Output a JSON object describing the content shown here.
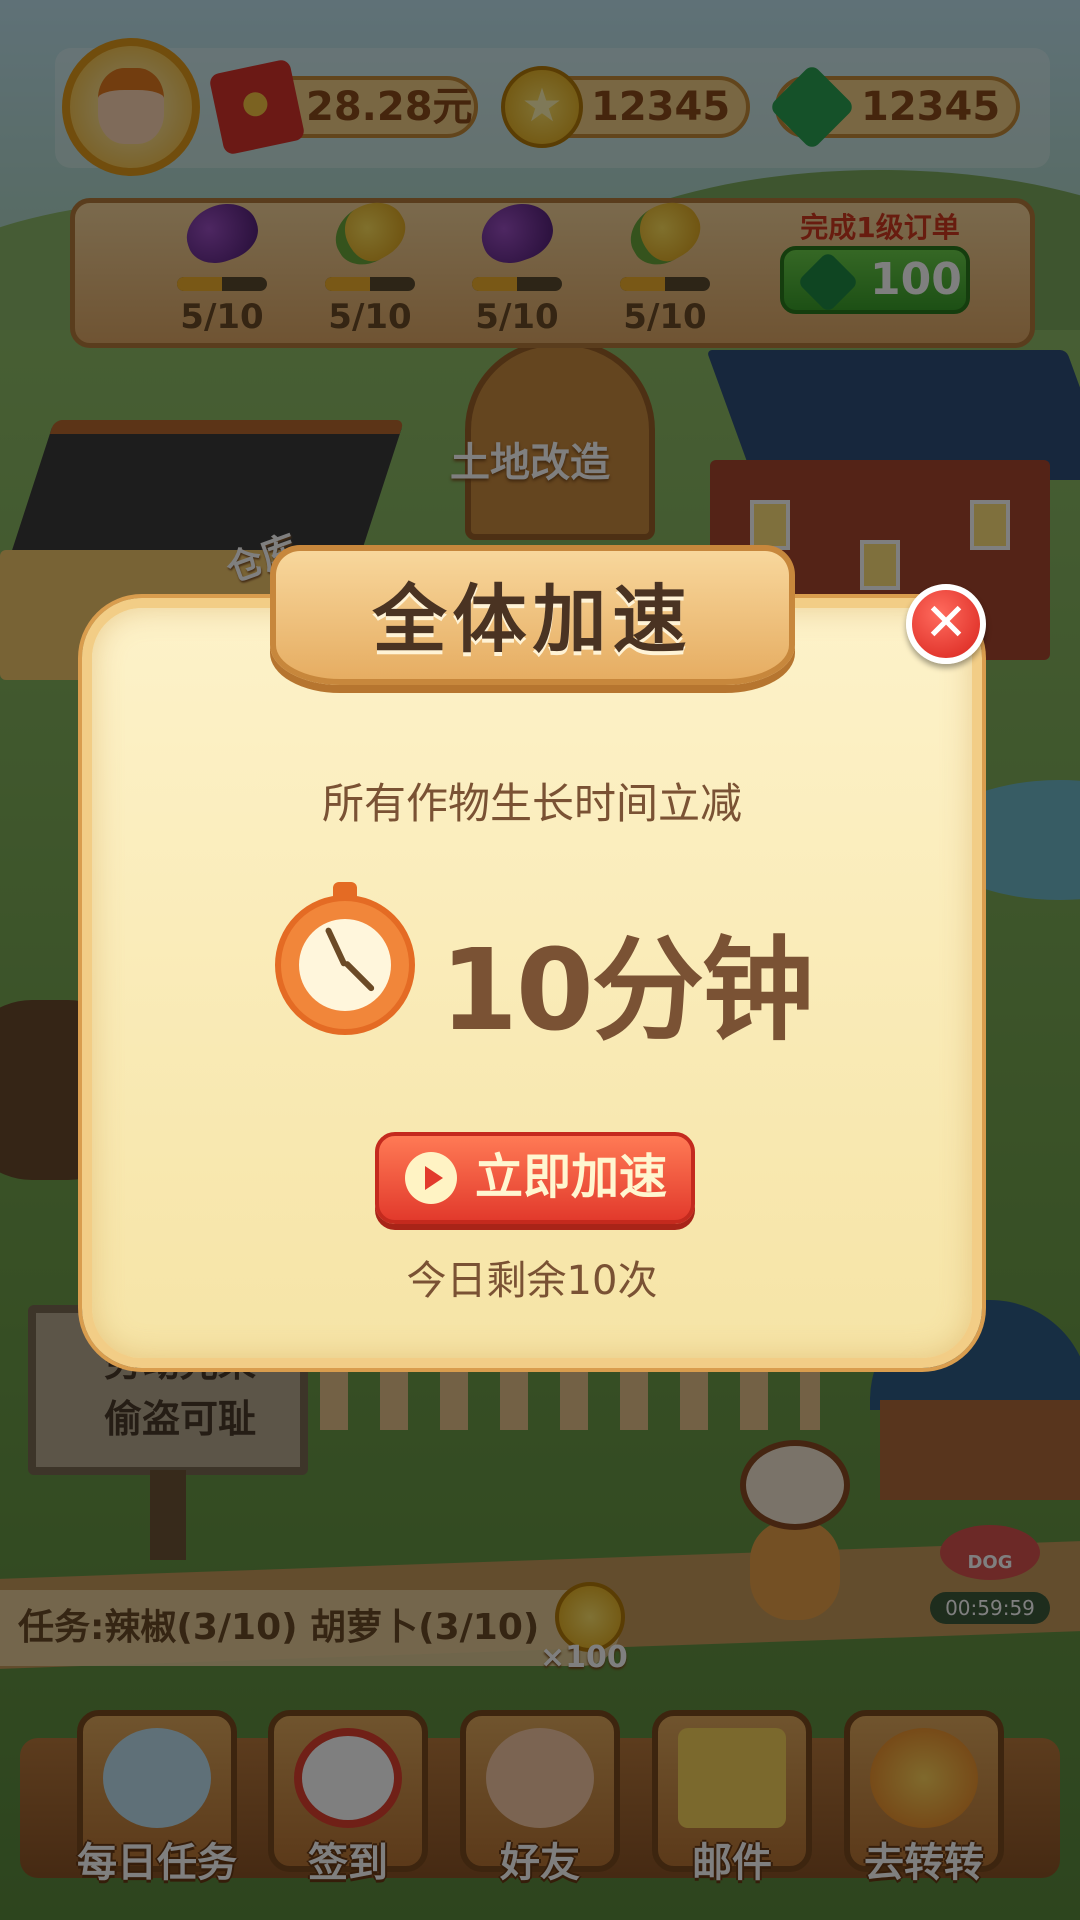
{
  "hud": {
    "cash": "28.28元",
    "coins": "12345",
    "gems": "12345"
  },
  "order": {
    "items": [
      {
        "crop": "eggplant",
        "count": "5/10",
        "progress": 0.5
      },
      {
        "crop": "corn",
        "count": "5/10",
        "progress": 0.5
      },
      {
        "crop": "eggplant",
        "count": "5/10",
        "progress": 0.5
      },
      {
        "crop": "corn",
        "count": "5/10",
        "progress": 0.5
      }
    ],
    "title": "完成1级订单",
    "reward": "100"
  },
  "scene": {
    "warehouse_label": "仓库",
    "land_label": "土地改造",
    "board_line1": "劳动光荣",
    "board_line2": "偷盗可耻",
    "dog_bowl_label": "DOG",
    "dog_timer": "00:59:59"
  },
  "task": {
    "text": "任务:辣椒(3/10)   胡萝卜(3/10)",
    "reward_multiplier": "×100"
  },
  "nav": [
    {
      "label": "每日任务",
      "icon": "daily-task-icon"
    },
    {
      "label": "签到",
      "icon": "alarm-clock-icon"
    },
    {
      "label": "好友",
      "icon": "friends-icon"
    },
    {
      "label": "邮件",
      "icon": "mail-icon"
    },
    {
      "label": "去转转",
      "icon": "spiral-icon"
    }
  ],
  "popup": {
    "title": "全体加速",
    "description": "所有作物生长时间立减",
    "amount": "10分钟",
    "button": "立即加速",
    "remaining": "今日剩余10次",
    "close_icon": "close-icon"
  },
  "colors": {
    "accent_red": "#e23a2c",
    "panel_bg": "#fdf2c9",
    "text_brown": "#7a5234"
  }
}
